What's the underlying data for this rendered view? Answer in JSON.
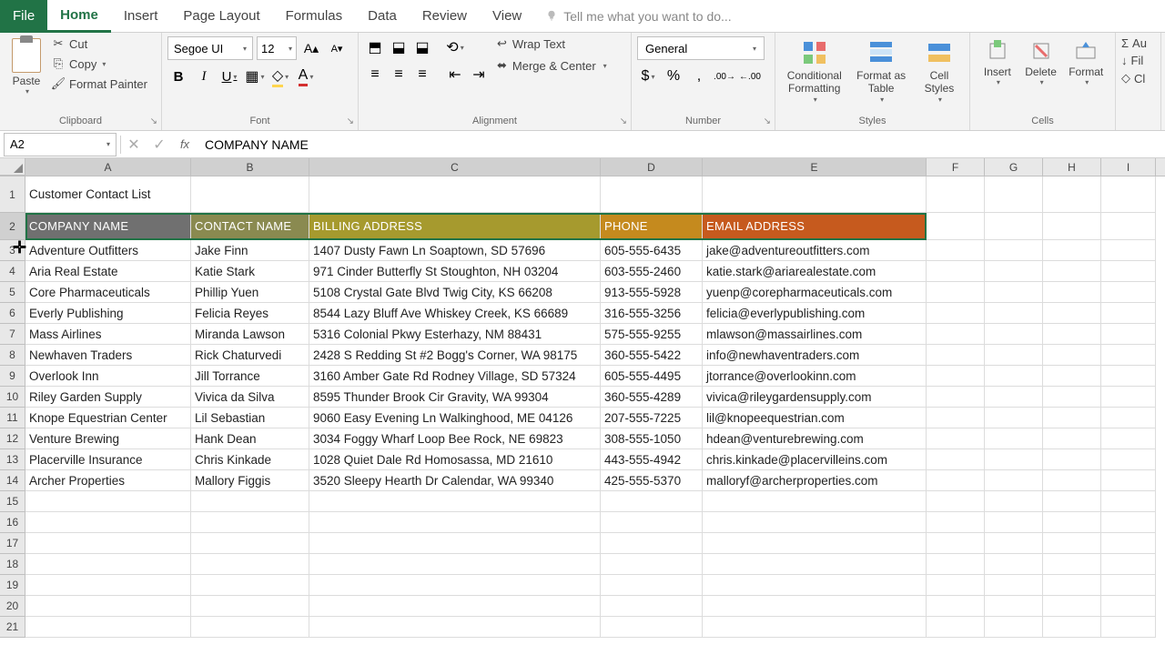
{
  "tabs": {
    "file": "File",
    "home": "Home",
    "insert": "Insert",
    "page_layout": "Page Layout",
    "formulas": "Formulas",
    "data": "Data",
    "review": "Review",
    "view": "View",
    "tell_me": "Tell me what you want to do..."
  },
  "ribbon": {
    "clipboard": {
      "paste": "Paste",
      "cut": "Cut",
      "copy": "Copy",
      "format_painter": "Format Painter",
      "label": "Clipboard"
    },
    "font": {
      "name": "Segoe UI",
      "size": "12",
      "label": "Font"
    },
    "alignment": {
      "wrap": "Wrap Text",
      "merge": "Merge & Center",
      "label": "Alignment"
    },
    "number": {
      "format": "General",
      "label": "Number"
    },
    "styles": {
      "conditional": "Conditional Formatting",
      "format_table": "Format as Table",
      "cell_styles": "Cell Styles",
      "label": "Styles"
    },
    "cells": {
      "insert": "Insert",
      "delete": "Delete",
      "format": "Format",
      "label": "Cells"
    },
    "editing": {
      "autosum": "Au",
      "fill": "Fil",
      "clear": "Cl"
    }
  },
  "formula_bar": {
    "name_box": "A2",
    "value": "COMPANY NAME"
  },
  "columns": [
    "A",
    "B",
    "C",
    "D",
    "E",
    "F",
    "G",
    "H",
    "I"
  ],
  "sheet": {
    "title": "Customer Contact List",
    "headers": [
      "COMPANY NAME",
      "CONTACT NAME",
      "BILLING ADDRESS",
      "PHONE",
      "EMAIL ADDRESS"
    ],
    "header_colors": [
      "#707070",
      "#8a8a50",
      "#a69a2e",
      "#c58a1e",
      "#c65a1e"
    ],
    "rows": [
      [
        "Adventure Outfitters",
        "Jake Finn",
        "1407 Dusty Fawn Ln Soaptown, SD 57696",
        "605-555-6435",
        "jake@adventureoutfitters.com"
      ],
      [
        "Aria Real Estate",
        "Katie Stark",
        "971 Cinder Butterfly St Stoughton, NH 03204",
        "603-555-2460",
        "katie.stark@ariarealestate.com"
      ],
      [
        "Core Pharmaceuticals",
        "Phillip Yuen",
        "5108 Crystal Gate Blvd Twig City, KS 66208",
        "913-555-5928",
        "yuenp@corepharmaceuticals.com"
      ],
      [
        "Everly Publishing",
        "Felicia Reyes",
        "8544 Lazy Bluff Ave Whiskey Creek, KS 66689",
        "316-555-3256",
        "felicia@everlypublishing.com"
      ],
      [
        "Mass Airlines",
        "Miranda Lawson",
        "5316 Colonial Pkwy Esterhazy, NM 88431",
        "575-555-9255",
        "mlawson@massairlines.com"
      ],
      [
        "Newhaven Traders",
        "Rick Chaturvedi",
        "2428 S Redding St #2 Bogg's Corner, WA 98175",
        "360-555-5422",
        "info@newhaventraders.com"
      ],
      [
        "Overlook Inn",
        "Jill Torrance",
        "3160 Amber Gate Rd Rodney Village, SD 57324",
        "605-555-4495",
        "jtorrance@overlookinn.com"
      ],
      [
        "Riley Garden Supply",
        "Vivica da Silva",
        "8595 Thunder Brook Cir Gravity, WA 99304",
        "360-555-4289",
        "vivica@rileygardensupply.com"
      ],
      [
        "Knope Equestrian Center",
        "Lil Sebastian",
        "9060 Easy Evening Ln Walkinghood, ME 04126",
        "207-555-7225",
        "lil@knopeequestrian.com"
      ],
      [
        "Venture Brewing",
        "Hank Dean",
        "3034 Foggy Wharf Loop Bee Rock, NE 69823",
        "308-555-1050",
        "hdean@venturebrewing.com"
      ],
      [
        "Placerville Insurance",
        "Chris Kinkade",
        "1028 Quiet Dale Rd Homosassa, MD 21610",
        "443-555-4942",
        "chris.kinkade@placervilleins.com"
      ],
      [
        "Archer Properties",
        "Mallory Figgis",
        "3520 Sleepy Hearth Dr Calendar, WA 99340",
        "425-555-5370",
        "malloryf@archerproperties.com"
      ]
    ]
  },
  "empty_rows": [
    "15",
    "16",
    "17",
    "18",
    "19",
    "20",
    "21"
  ]
}
